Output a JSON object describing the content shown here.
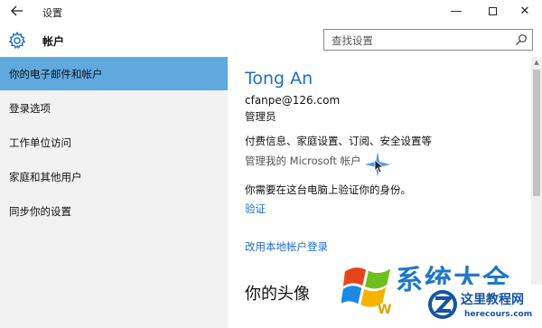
{
  "window": {
    "title": "设置",
    "back_icon": "back-arrow-icon",
    "minimize_label": "—",
    "close_label": "✕"
  },
  "header": {
    "icon": "gear-icon",
    "title": "帐户",
    "search_placeholder": "查找设置",
    "search_icon": "search-icon"
  },
  "sidebar": {
    "items": [
      {
        "label": "你的电子邮件和帐户",
        "active": true
      },
      {
        "label": "登录选项",
        "active": false
      },
      {
        "label": "工作单位访问",
        "active": false
      },
      {
        "label": "家庭和其他用户",
        "active": false
      },
      {
        "label": "同步你的设置",
        "active": false
      }
    ]
  },
  "account": {
    "name": "Tong An",
    "email": "cfanpe@126.com",
    "role": "管理员",
    "billing_text": "付费信息、家庭设置、订阅、安全设置等",
    "manage_link": "管理我的 Microsoft 帐户",
    "verify_text": "你需要在这台电脑上验证你的身份。",
    "verify_link": "验证",
    "local_link": "改用本地帐户登录",
    "avatar_heading": "你的头像"
  },
  "watermark": {
    "brand": "系统大全",
    "letter": "W",
    "site_cn": "这里教程网",
    "site_url": "herecours.com"
  },
  "colors": {
    "accent": "#1d6fc2",
    "sidebar_active": "#5fa9df",
    "sidebar_bg": "#f2f2f2"
  }
}
